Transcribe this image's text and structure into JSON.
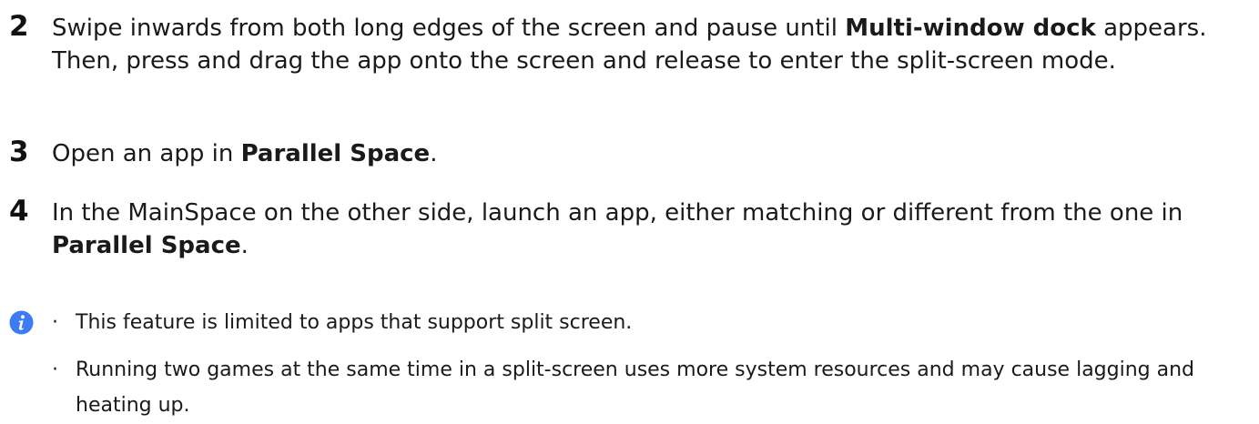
{
  "steps": [
    {
      "number": "2",
      "parts": [
        {
          "text": "Swipe inwards from both long edges of the screen and pause until ",
          "bold": false
        },
        {
          "text": "Multi-window dock",
          "bold": true
        },
        {
          "text": " appears. Then, press and drag the app onto the screen and release to enter the split-screen mode.",
          "bold": false
        }
      ]
    },
    {
      "number": "3",
      "parts": [
        {
          "text": "Open an app in ",
          "bold": false
        },
        {
          "text": "Parallel Space",
          "bold": true
        },
        {
          "text": ".",
          "bold": false
        }
      ]
    },
    {
      "number": "4",
      "parts": [
        {
          "text": "In the MainSpace on the other side, launch an app, either matching or different from the one in ",
          "bold": false
        },
        {
          "text": "Parallel Space",
          "bold": true
        },
        {
          "text": ".",
          "bold": false
        }
      ]
    }
  ],
  "note": {
    "icon": "info-icon",
    "icon_color": "#3d7bf5",
    "bullet_symbol": "·",
    "items": [
      "This feature is limited to apps that support split screen.",
      "Running two games at the same time in a split-screen uses more system resources and may cause lagging and heating up."
    ]
  }
}
